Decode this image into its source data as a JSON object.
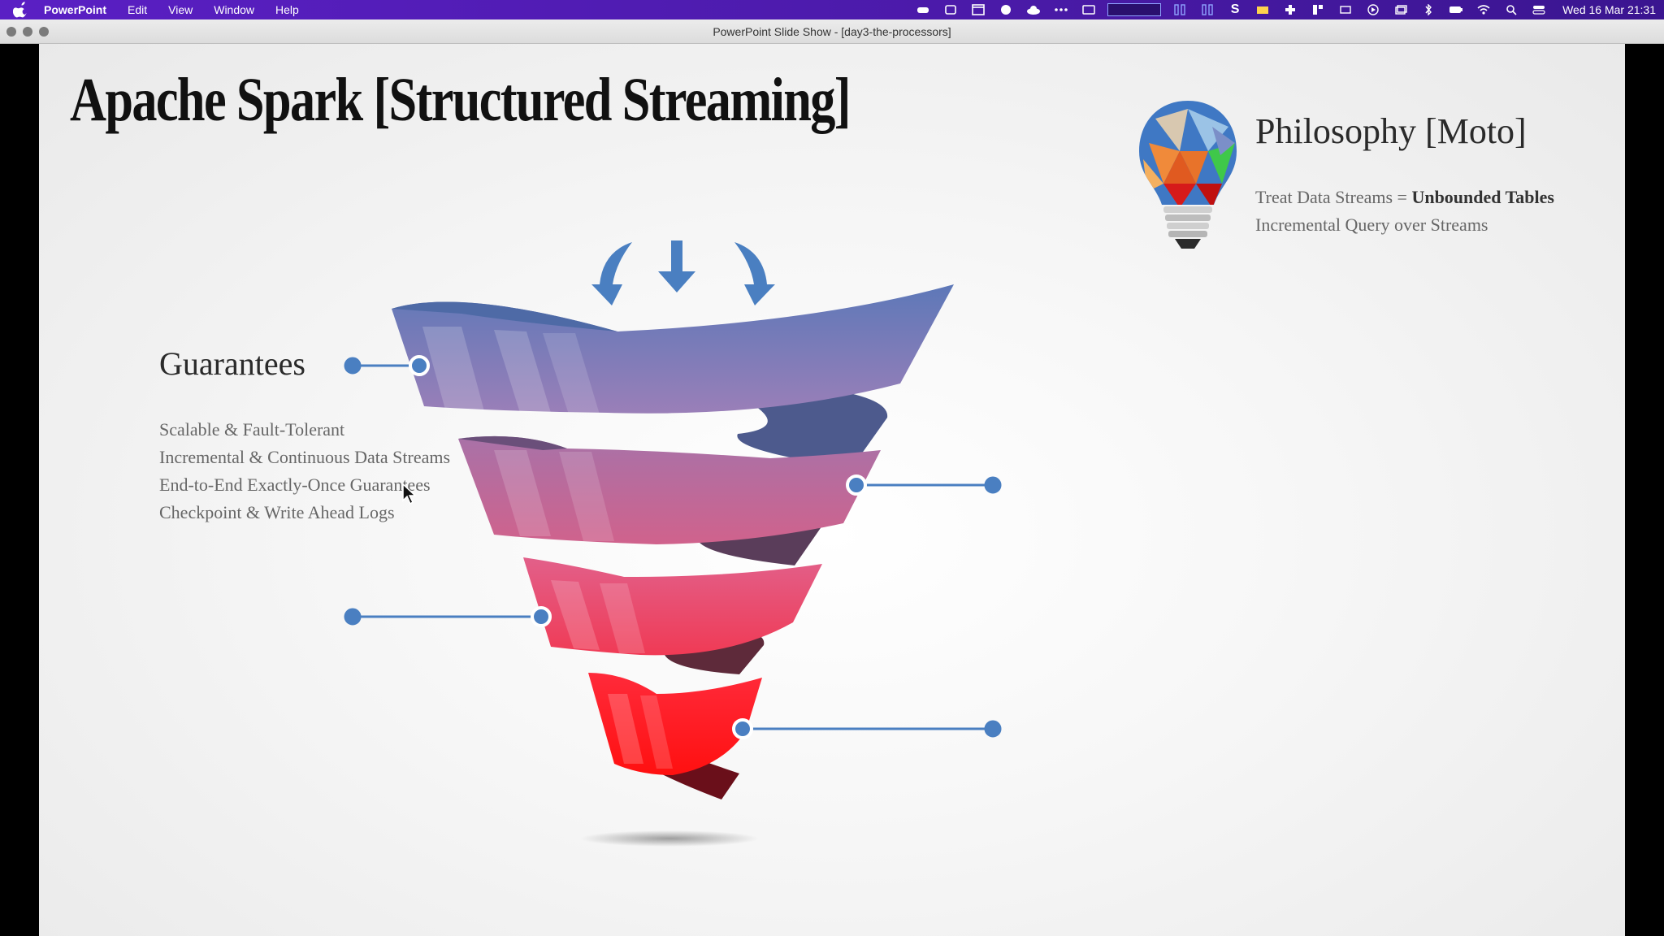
{
  "menubar": {
    "app_name": "PowerPoint",
    "menus": [
      "Edit",
      "View",
      "Window",
      "Help"
    ],
    "clock": "Wed 16 Mar  21:31"
  },
  "window": {
    "title": "PowerPoint Slide Show - [day3-the-processors]"
  },
  "slide": {
    "title": "Apache Spark [Structured Streaming]",
    "guarantees": {
      "heading": "Guarantees",
      "items": [
        "Scalable & Fault-Tolerant",
        "Incremental & Continuous Data Streams",
        "End-to-End Exactly-Once Guarantees",
        "Checkpoint & Write Ahead Logs"
      ]
    },
    "philosophy": {
      "heading": "Philosophy [Moto]",
      "line1_prefix": "Treat Data Streams = ",
      "line1_emphasis": "Unbounded Tables",
      "line2": "Incremental Query over Streams"
    }
  },
  "colors": {
    "menubar": "#4a1aa8",
    "connector": "#4a7fc1",
    "funnel_top": "#6f7fc0",
    "funnel_bottom": "#ff1a1a"
  },
  "icons": [
    "apple-icon",
    "lightbulb-icon",
    "arrow-down-icon",
    "mouse-cursor-icon"
  ]
}
